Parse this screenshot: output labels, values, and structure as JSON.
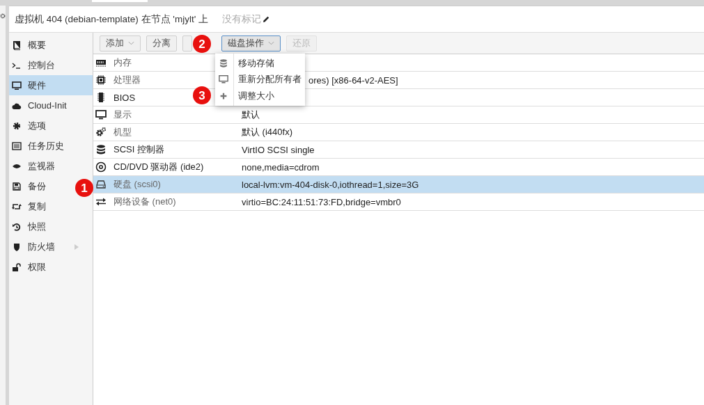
{
  "header": {
    "title": "虚拟机 404 (debian-template) 在节点 'mjylt' 上",
    "tags": "没有标记"
  },
  "sidebar": {
    "items": [
      {
        "label": "概要",
        "selected": false,
        "submenu": false
      },
      {
        "label": "控制台",
        "selected": false,
        "submenu": false
      },
      {
        "label": "硬件",
        "selected": true,
        "submenu": false
      },
      {
        "label": "Cloud-Init",
        "selected": false,
        "submenu": false
      },
      {
        "label": "选项",
        "selected": false,
        "submenu": false
      },
      {
        "label": "任务历史",
        "selected": false,
        "submenu": false
      },
      {
        "label": "监视器",
        "selected": false,
        "submenu": false
      },
      {
        "label": "备份",
        "selected": false,
        "submenu": false
      },
      {
        "label": "复制",
        "selected": false,
        "submenu": false
      },
      {
        "label": "快照",
        "selected": false,
        "submenu": false
      },
      {
        "label": "防火墙",
        "selected": false,
        "submenu": true
      },
      {
        "label": "权限",
        "selected": false,
        "submenu": false
      }
    ]
  },
  "toolbar": [
    {
      "label": "添加",
      "dropdown": true,
      "disabled": false,
      "pressed": false
    },
    {
      "label": "分离",
      "dropdown": false,
      "disabled": false,
      "pressed": false
    },
    {
      "dropdown": false,
      "disabled": false,
      "pressed": false
    },
    {
      "label": "磁盘操作",
      "dropdown": true,
      "disabled": false,
      "pressed": true
    },
    {
      "label": "还原",
      "dropdown": false,
      "disabled": true,
      "pressed": false
    }
  ],
  "menu": [
    {
      "label": "移动存储"
    },
    {
      "label": "重新分配所有者"
    },
    {
      "label": "调整大小"
    }
  ],
  "rows": [
    {
      "name": "内存",
      "dimmed": true,
      "selected": false
    },
    {
      "name": "处理器",
      "value": "ores) [x86-64-v2-AES]",
      "dimmed": true,
      "selected": false
    },
    {
      "name": "BIOS",
      "dimmed": false,
      "selected": false
    },
    {
      "name": "显示",
      "value": "默认",
      "dimmed": true,
      "selected": false
    },
    {
      "name": "机型",
      "value": "默认 (i440fx)",
      "dimmed": true,
      "selected": false
    },
    {
      "name": "SCSI 控制器",
      "value": "VirtIO SCSI single",
      "dimmed": false,
      "selected": false
    },
    {
      "name": "CD/DVD 驱动器 (ide2)",
      "value": "none,media=cdrom",
      "dimmed": false,
      "selected": false
    },
    {
      "name": "硬盘 (scsi0)",
      "value": "local-lvm:vm-404-disk-0,iothread=1,size=3G",
      "dimmed": true,
      "selected": true
    },
    {
      "name": "网络设备 (net0)",
      "value": "virtio=BC:24:11:51:73:FD,bridge=vmbr0",
      "dimmed": true,
      "selected": false
    }
  ],
  "callouts": [
    "1",
    "2",
    "3"
  ]
}
